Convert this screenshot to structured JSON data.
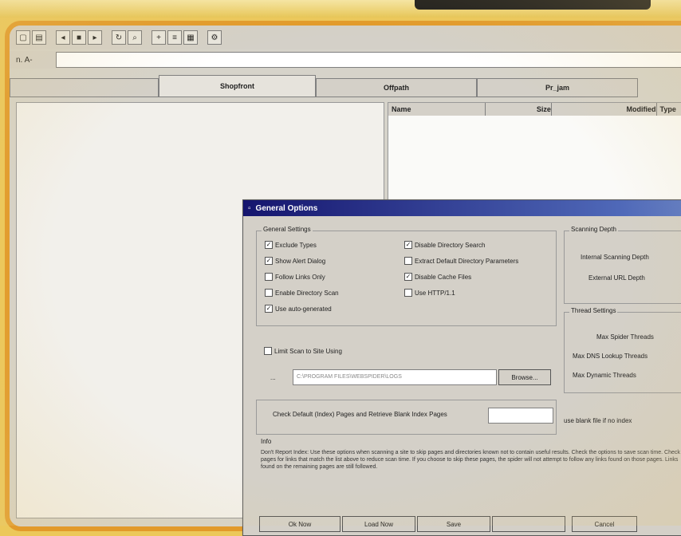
{
  "toolbar": {
    "icons": [
      "open-icon",
      "save-icon",
      "back-icon",
      "stop-icon",
      "play-icon",
      "refresh-icon",
      "search-icon",
      "new-icon",
      "list-icon",
      "grid-icon",
      "options-icon"
    ]
  },
  "address": {
    "label": "n. A-",
    "value": ""
  },
  "tabs": [
    {
      "label": "",
      "active": false
    },
    {
      "label": "Shopfront",
      "active": true
    },
    {
      "label": "Offpath",
      "active": false
    },
    {
      "label": "Pr_jam",
      "active": false
    }
  ],
  "list_columns": [
    "Name",
    "Size",
    "Modified",
    "Type"
  ],
  "dialog": {
    "title": "General Options",
    "general": {
      "legend": "General Settings",
      "left": [
        {
          "label": "Exclude Types",
          "checked": true
        },
        {
          "label": "Show Alert Dialog",
          "checked": true
        },
        {
          "label": "Follow Links Only",
          "checked": false
        },
        {
          "label": "Enable Directory Scan",
          "checked": false
        },
        {
          "label": "Use auto-generated",
          "checked": true
        }
      ],
      "right": [
        {
          "label": "Disable Directory Search",
          "checked": true
        },
        {
          "label": "Extract Default Directory Parameters",
          "checked": false
        },
        {
          "label": "Disable Cache Files",
          "checked": true
        },
        {
          "label": "Use HTTP/1.1",
          "checked": false
        }
      ]
    },
    "scanning": {
      "legend": "Scanning Depth",
      "internal": "Internal Scanning Depth",
      "external": "External URL Depth"
    },
    "thread": {
      "legend": "Thread Settings",
      "max": "Max Spider Threads",
      "dns": "Max DNS Lookup Threads",
      "dyn": "Max Dynamic Threads"
    },
    "limit": {
      "label": "Limit Scan to Site Using",
      "checked": false,
      "path_label": "...",
      "path_value": "C:\\PROGRAM FILES\\WEBSPIDER\\LOGS",
      "browse": "Browse..."
    },
    "default_pages": {
      "label": "Check Default (Index) Pages and Retrieve Blank Index Pages",
      "value": "",
      "after": "use blank file if no index"
    },
    "help_label": "Info",
    "description": "Don't Report Index: Use these options when scanning a site to skip pages and directories known not to contain useful results. Check the options to save scan time. Check pages for links that match the list above to reduce scan time. If you choose to skip these pages, the spider will not attempt to follow any links found on those pages. Links found on the remaining pages are still followed.",
    "buttons": [
      "Ok Now",
      "Load Now",
      "Save",
      "",
      "Cancel"
    ]
  }
}
